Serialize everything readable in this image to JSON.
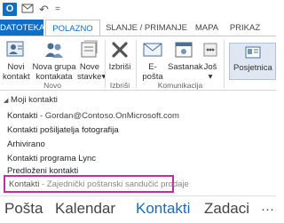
{
  "app": {
    "icon_letter": "O"
  },
  "qat": {
    "sendreceive_icon": "sendreceive-icon",
    "undo_glyph": "↶",
    "dropdown_glyph": "="
  },
  "tabs": [
    {
      "label": "DATOTEKA"
    },
    {
      "label": "POLAZNO"
    },
    {
      "label": "SLANJE / PRIMANJE"
    },
    {
      "label": "MAPA"
    },
    {
      "label": "PRIKAZ"
    }
  ],
  "ribbon": {
    "novo": {
      "label": "Novo",
      "novi_kontakt": [
        "Novi",
        "kontakt"
      ],
      "nova_grupa": [
        "Nova grupa",
        "kontakata"
      ],
      "nove_stavke": [
        "Nove",
        "stavke"
      ],
      "dropdown": "▾"
    },
    "izbrisi_group": {
      "label": "Izbriši",
      "izbrisi": "Izbriši"
    },
    "komunikacija": {
      "label": "Komunikacija",
      "eposta": "E-pošta",
      "sastanak": "Sastanak",
      "jos": "Još"
    },
    "posjetnica": "Posjetnica"
  },
  "folders": {
    "section_title": "Moji kontakti",
    "collapse_glyph": "◢",
    "items": [
      {
        "name": "Kontakti",
        "sub": " - Gordan@Contoso.OnMicrosoft.com"
      },
      {
        "name": "Kontakti pošiljatelja fotografija"
      },
      {
        "name": "Arhivirano"
      },
      {
        "name": "Kontakti programa Lync"
      },
      {
        "name": "Predloženi kontakti"
      }
    ],
    "selected": {
      "name": "Kontakti",
      "sub": " - Zajednički poštanski sandučić prodaje"
    }
  },
  "nav": [
    {
      "label": "Pošta"
    },
    {
      "label": "Kalendar"
    },
    {
      "label": "Kontakti"
    },
    {
      "label": "Zadaci"
    }
  ],
  "colors": {
    "accent": "#0f6fc6",
    "highlight_border": "#c0309b"
  }
}
